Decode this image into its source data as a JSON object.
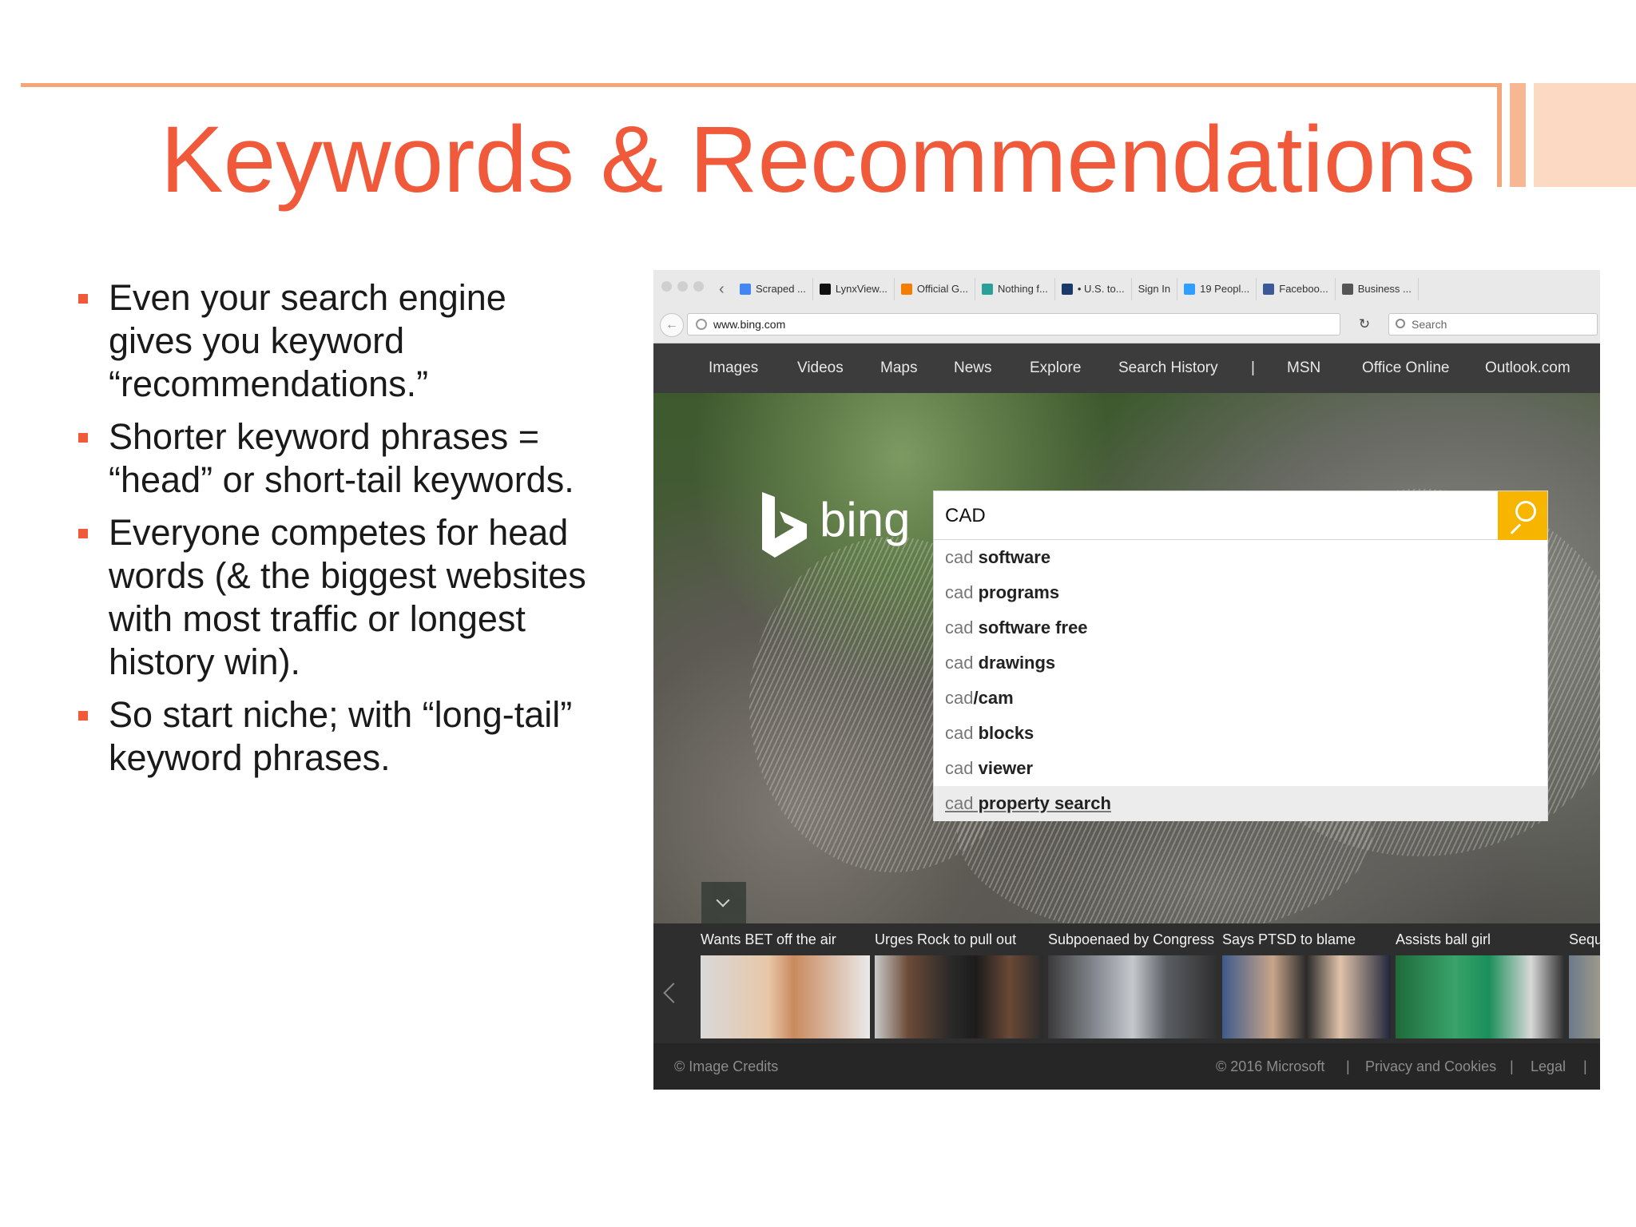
{
  "slide": {
    "title": "Keywords & Recommendations",
    "bullets": [
      "Even your search engine gives you keyword “recommendations.”",
      "Shorter keyword phrases = “head” or short-tail keywords.",
      "Everyone competes for head words (& the biggest websites with most traffic or longest history win).",
      "So start niche; with “long-tail” keyword phrases."
    ],
    "accent_color": "#f05a3a"
  },
  "browser": {
    "bookmarks": [
      {
        "label": "Scraped ...",
        "icon": "google-icon",
        "color": "#4285f4"
      },
      {
        "label": "LynxView...",
        "icon": "lynx-icon",
        "color": "#111111"
      },
      {
        "label": "Official G...",
        "icon": "blogger-icon",
        "color": "#f57d00"
      },
      {
        "label": "Nothing f...",
        "icon": "leaf-icon",
        "color": "#2aa198"
      },
      {
        "label": "• U.S. to...",
        "icon": "edit-icon",
        "color": "#1a3a6b"
      },
      {
        "label": "Sign In",
        "icon": "",
        "color": ""
      },
      {
        "label": "19 Peopl...",
        "icon": "disqus-icon",
        "color": "#2e9fff"
      },
      {
        "label": "Faceboo...",
        "icon": "facebook-icon",
        "color": "#3b5998"
      },
      {
        "label": "Business ...",
        "icon": "calendar-icon",
        "color": "#555555"
      }
    ],
    "url": "www.bing.com",
    "search_placeholder": "Search"
  },
  "bing": {
    "nav": [
      "Images",
      "Videos",
      "Maps",
      "News",
      "Explore",
      "Search History",
      "|",
      "MSN",
      "Office Online",
      "Outlook.com"
    ],
    "logo_text": "bing",
    "query": "CAD",
    "suggestions": [
      {
        "prefix": "cad",
        "rest": " software"
      },
      {
        "prefix": "cad",
        "rest": " programs"
      },
      {
        "prefix": "cad",
        "rest": " software free"
      },
      {
        "prefix": "cad",
        "rest": " drawings"
      },
      {
        "prefix": "cad",
        "rest": "/cam"
      },
      {
        "prefix": "cad",
        "rest": " blocks"
      },
      {
        "prefix": "cad",
        "rest": " viewer"
      },
      {
        "prefix": "cad",
        "rest": " property search"
      }
    ],
    "news": [
      "Wants BET off the air",
      "Urges Rock to pull out",
      "Subpoenaed by Congress",
      "Says PTSD to blame",
      "Assists ball girl",
      "Sequ"
    ],
    "footer": {
      "credits": "© Image Credits",
      "copyright": "© 2016 Microsoft",
      "sep": "|",
      "privacy": "Privacy and Cookies",
      "legal": "Legal"
    },
    "search_button_color": "#f7b500"
  }
}
